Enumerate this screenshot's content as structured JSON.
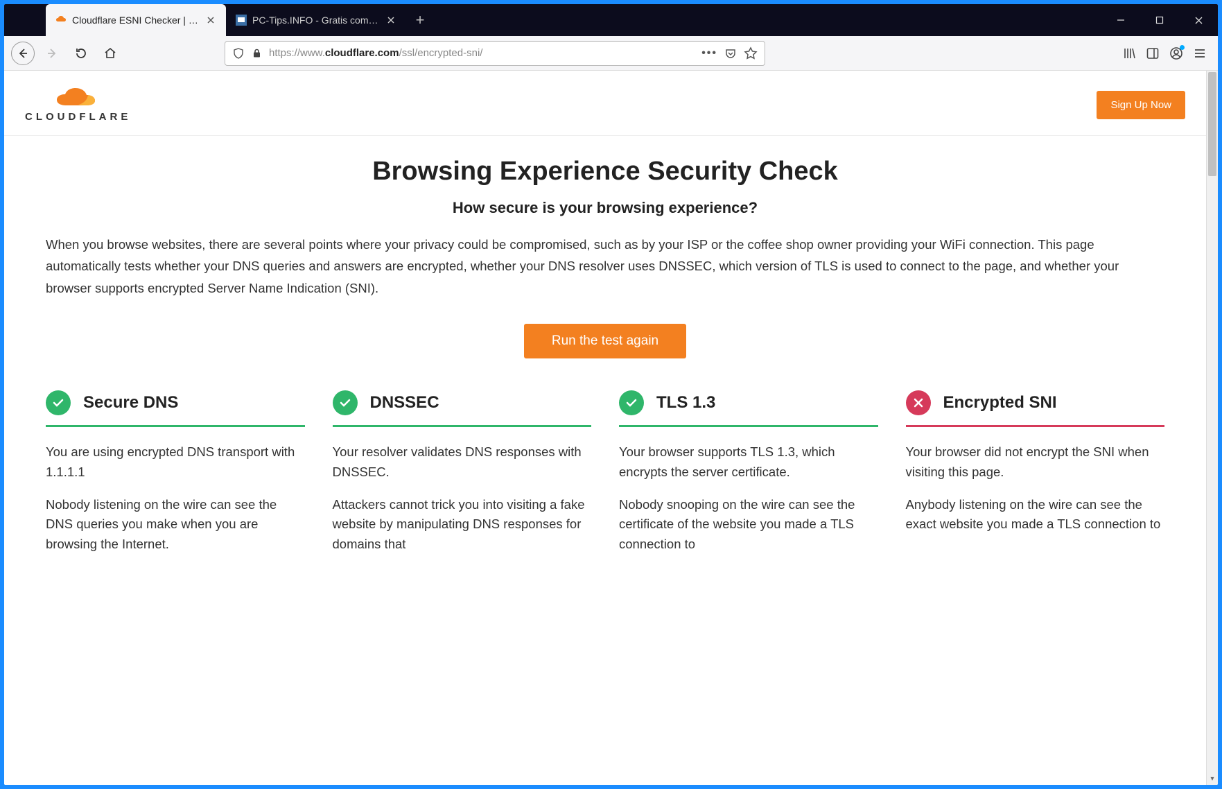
{
  "window": {
    "tabs": [
      {
        "label": "Cloudflare ESNI Checker | Cloud",
        "active": true
      },
      {
        "label": "PC-Tips.INFO - Gratis compute",
        "active": false
      }
    ]
  },
  "toolbar": {
    "url_prefix": "https://www.",
    "url_host": "cloudflare.com",
    "url_path": "/ssl/encrypted-sni/"
  },
  "header": {
    "brand": "CLOUDFLARE",
    "signup": "Sign Up Now"
  },
  "main": {
    "title": "Browsing Experience Security Check",
    "subtitle": "How secure is your browsing experience?",
    "intro": "When you browse websites, there are several points where your privacy could be compromised, such as by your ISP or the coffee shop owner providing your WiFi connection. This page automatically tests whether your DNS queries and answers are encrypted, whether your DNS resolver uses DNSSEC, which version of TLS is used to connect to the page, and whether your browser supports encrypted Server Name Indication (SNI).",
    "run_button": "Run the test again"
  },
  "cards": [
    {
      "status": "ok",
      "title": "Secure DNS",
      "p1": "You are using encrypted DNS transport with 1.1.1.1",
      "p2": "Nobody listening on the wire can see the DNS queries you make when you are browsing the Internet."
    },
    {
      "status": "ok",
      "title": "DNSSEC",
      "p1": "Your resolver validates DNS responses with DNSSEC.",
      "p2": "Attackers cannot trick you into visiting a fake website by manipulating DNS responses for domains that"
    },
    {
      "status": "ok",
      "title": "TLS 1.3",
      "p1": "Your browser supports TLS 1.3, which encrypts the server certificate.",
      "p2": "Nobody snooping on the wire can see the certificate of the website you made a TLS connection to"
    },
    {
      "status": "fail",
      "title": "Encrypted SNI",
      "p1": "Your browser did not encrypt the SNI when visiting this page.",
      "p2": "Anybody listening on the wire can see the exact website you made a TLS connection to"
    }
  ]
}
